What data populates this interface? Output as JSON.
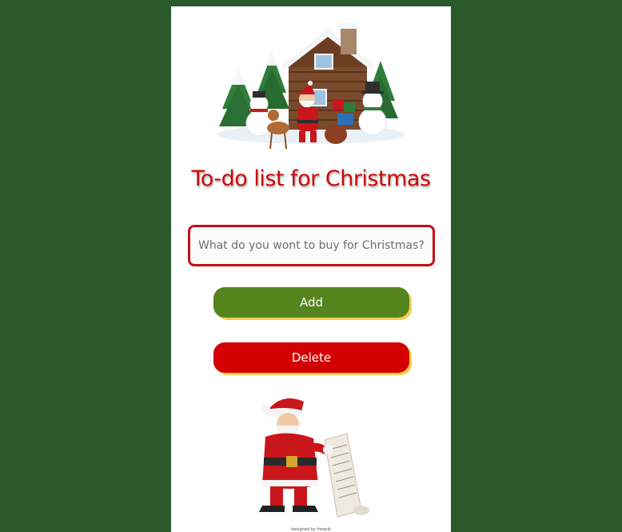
{
  "page": {
    "title": "To-do list for Christmas"
  },
  "form": {
    "placeholder": "What do you wont to buy for Christmas?",
    "value": "",
    "add_label": "Add",
    "delete_label": "Delete"
  },
  "images": {
    "hero": "christmas-cabin-santa-snowmen-illustration",
    "santa": "santa-reading-list-illustration"
  },
  "footer": {
    "credit": "designed by freepik"
  },
  "colors": {
    "background": "#2a5a2b",
    "title": "#cc0a0a",
    "add_button": "#55841e",
    "delete_button": "#d20000",
    "button_shadow": "#f3d04a",
    "input_border": "#c60f16"
  }
}
